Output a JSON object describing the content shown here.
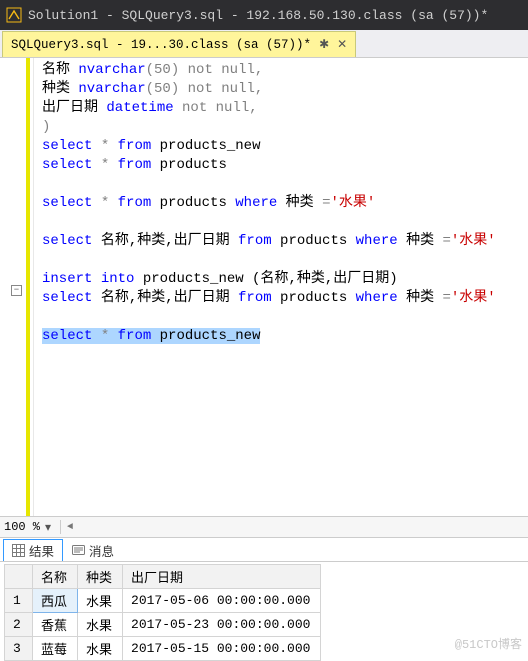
{
  "title_bar": {
    "text": "Solution1 - SQLQuery3.sql - 192.168.50.130.class (sa (57))*"
  },
  "tab": {
    "label": "SQLQuery3.sql - 19...30.class (sa (57))*",
    "pin_glyph": "✱",
    "close_glyph": "✕"
  },
  "code": {
    "l1": {
      "a": "名称 ",
      "b": "nvarchar",
      "c": "(50) ",
      "d": "not",
      "e": " null,"
    },
    "l2": {
      "a": "种类 ",
      "b": "nvarchar",
      "c": "(50) ",
      "d": "not",
      "e": " null,"
    },
    "l3": {
      "a": "出厂日期 ",
      "b": "datetime ",
      "c": "not",
      "d": " null,"
    },
    "l4": ")",
    "l5": {
      "a": "select",
      "b": " * ",
      "c": "from",
      "d": " products_new"
    },
    "l6": {
      "a": "select",
      "b": " * ",
      "c": "from",
      "d": " products"
    },
    "l7": {
      "a": "select",
      "b": " * ",
      "c": "from",
      "d": " products ",
      "e": "where",
      "f": " 种类 ",
      "g": "=",
      "h": "'水果'"
    },
    "l8": {
      "a": "select",
      "b": " 名称,种类,出厂日期 ",
      "c": "from",
      "d": " products ",
      "e": "where",
      "f": " 种类 ",
      "g": "=",
      "h": "'水果'"
    },
    "l9": {
      "a": "insert",
      "b": " ",
      "c": "into",
      "d": " products_new (名称,种类,出厂日期)"
    },
    "l10": {
      "a": "select",
      "b": " 名称,种类,出厂日期 ",
      "c": "from",
      "d": " products ",
      "e": "where",
      "f": " 种类 ",
      "g": "=",
      "h": "'水果'"
    },
    "l11": {
      "a": "select",
      "b": " ",
      "c": "*",
      "d": " ",
      "e": "from",
      "f": " products_new"
    }
  },
  "zoom": {
    "value": "100 %",
    "arrow_left": "◄"
  },
  "results_tabs": {
    "results": "结果",
    "messages": "消息"
  },
  "grid": {
    "headers": {
      "c0": "",
      "c1": "名称",
      "c2": "种类",
      "c3": "出厂日期"
    },
    "rows": [
      {
        "n": "1",
        "name": "西瓜",
        "kind": "水果",
        "date": "2017-05-06 00:00:00.000"
      },
      {
        "n": "2",
        "name": "香蕉",
        "kind": "水果",
        "date": "2017-05-23 00:00:00.000"
      },
      {
        "n": "3",
        "name": "蓝莓",
        "kind": "水果",
        "date": "2017-05-15 00:00:00.000"
      }
    ]
  },
  "watermark": "@51CTO博客",
  "chart_data": {
    "type": "table",
    "title": "products_new",
    "columns": [
      "名称",
      "种类",
      "出厂日期"
    ],
    "rows": [
      [
        "西瓜",
        "水果",
        "2017-05-06 00:00:00.000"
      ],
      [
        "香蕉",
        "水果",
        "2017-05-23 00:00:00.000"
      ],
      [
        "蓝莓",
        "水果",
        "2017-05-15 00:00:00.000"
      ]
    ]
  }
}
